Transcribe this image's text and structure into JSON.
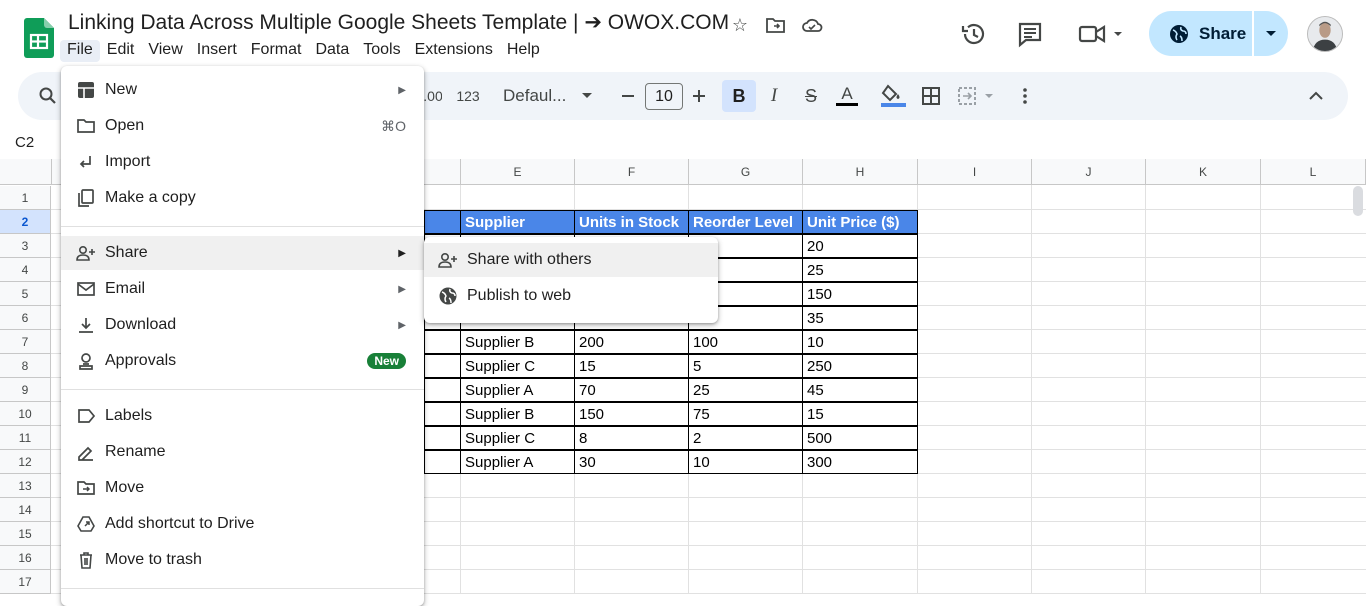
{
  "doc_title": "Linking Data Across Multiple Google Sheets Template | ➔ OWOX.COM",
  "menubar": [
    "File",
    "Edit",
    "View",
    "Insert",
    "Format",
    "Data",
    "Tools",
    "Extensions",
    "Help"
  ],
  "share_button": "Share",
  "toolbar": {
    "format_00": ".00",
    "format_123": "123",
    "font": "Defaul...",
    "font_size": "10",
    "bold": "B",
    "italic": "I",
    "strike": "S",
    "text_color": "A"
  },
  "name_box": "C2",
  "columns": [
    "E",
    "F",
    "G",
    "H",
    "I",
    "J",
    "K",
    "L"
  ],
  "rows": [
    "1",
    "2",
    "3",
    "4",
    "5",
    "6",
    "7",
    "8",
    "9",
    "10",
    "11",
    "12",
    "13",
    "14",
    "15",
    "16",
    "17"
  ],
  "table": {
    "headers": [
      "Supplier",
      "Units in Stock",
      "Reorder Level",
      "Unit Price ($)"
    ],
    "rows": [
      [
        "",
        "",
        "",
        "20"
      ],
      [
        "",
        "",
        "",
        "25"
      ],
      [
        "",
        "",
        "",
        "150"
      ],
      [
        "",
        "",
        "",
        "35"
      ],
      [
        "Supplier B",
        "200",
        "100",
        "10"
      ],
      [
        "Supplier C",
        "15",
        "5",
        "250"
      ],
      [
        "Supplier A",
        "70",
        "25",
        "45"
      ],
      [
        "Supplier B",
        "150",
        "75",
        "15"
      ],
      [
        "Supplier C",
        "8",
        "2",
        "500"
      ],
      [
        "Supplier A",
        "30",
        "10",
        "300"
      ]
    ]
  },
  "file_menu": {
    "new": "New",
    "open": "Open",
    "open_shortcut": "⌘O",
    "import": "Import",
    "make_copy": "Make a copy",
    "share": "Share",
    "email": "Email",
    "download": "Download",
    "approvals": "Approvals",
    "approvals_badge": "New",
    "labels": "Labels",
    "rename": "Rename",
    "move": "Move",
    "add_shortcut": "Add shortcut to Drive",
    "move_to_trash": "Move to trash"
  },
  "share_submenu": {
    "share_with_others": "Share with others",
    "publish_to_web": "Publish to web"
  },
  "colors": {
    "header_fill": "#4a86e8",
    "share_button": "#c2e7ff",
    "badge": "#188038",
    "sheets_green": "#0f9d58"
  }
}
